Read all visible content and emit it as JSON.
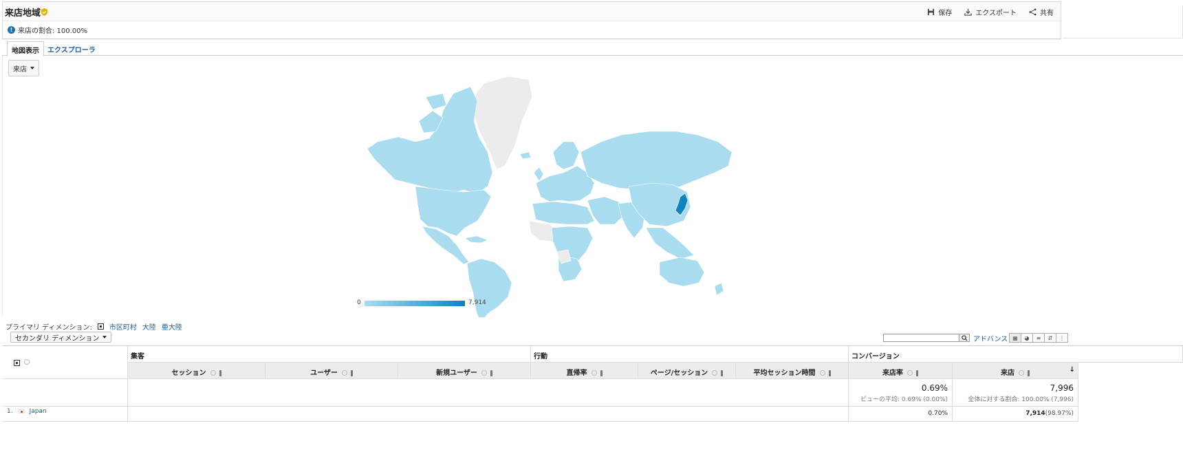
{
  "header": {
    "title": "来店地域",
    "actions": {
      "save": "保存",
      "export": "エクスポート",
      "share": "共有"
    },
    "info": "来店の割合: 100.00%"
  },
  "tabs": {
    "map": "地図表示",
    "explorer": "エクスプローラ"
  },
  "map": {
    "metric": "来店",
    "legend_min": "0",
    "legend_max": "7,914",
    "colors": {
      "low": "#a8ddf3",
      "high": "#0f82c1",
      "nodata": "#ececec"
    }
  },
  "dimensions": {
    "primary_label": "プライマリ ディメンション:",
    "options": [
      "市区町村",
      "大陸",
      "亜大陸"
    ],
    "secondary": "セカンダリ ディメンション"
  },
  "search": {
    "advanced": "アドバンス"
  },
  "table": {
    "groups": {
      "acquisition": "集客",
      "behavior": "行動",
      "conversion": "コンバージョン"
    },
    "columns": [
      "セッション",
      "ユーザー",
      "新規ユーザー",
      "直帰率",
      "ページ/セッション",
      "平均セッション時間",
      "来店率",
      "来店"
    ],
    "totals": {
      "rate": "0.69%",
      "rate_sub": "ビューの平均: 0.69% (0.00%)",
      "visits": "7,996",
      "visits_sub": "全体に対する割合: 100.00% (7,996)"
    },
    "rows": [
      {
        "num": "1.",
        "name": "Japan",
        "rate": "0.70%",
        "visits": "7,914",
        "visits_pct": "(98.97%)"
      }
    ]
  }
}
